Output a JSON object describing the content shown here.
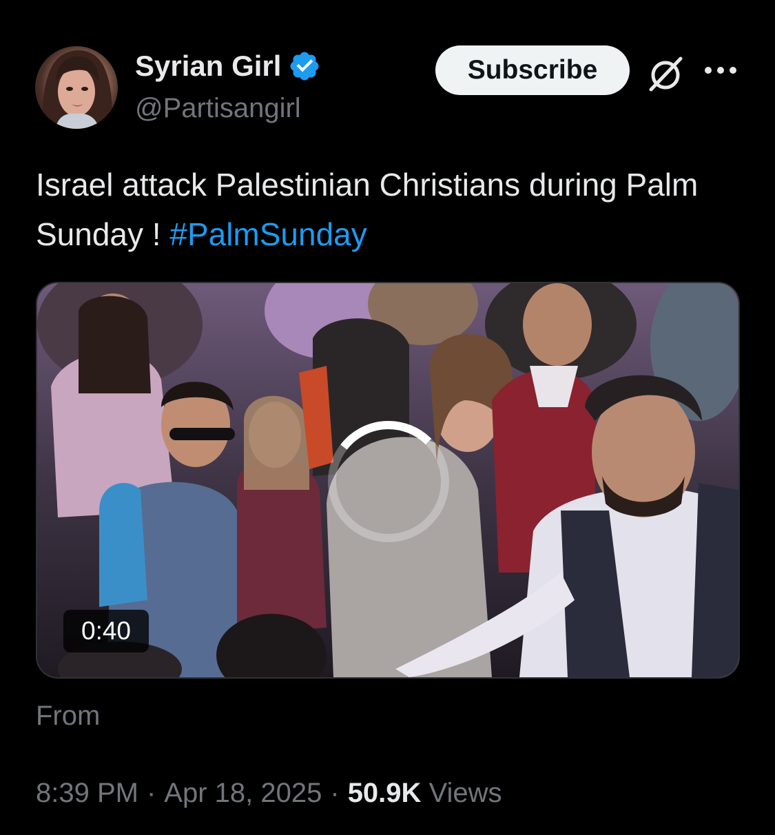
{
  "author": {
    "display_name": "Syrian Girl",
    "handle": "@Partisangirl",
    "verified": true,
    "verified_color": "#1d9bf0"
  },
  "actions": {
    "subscribe_label": "Subscribe",
    "grok_icon": "grok-icon",
    "more_icon": "more-horizontal-icon"
  },
  "tweet": {
    "text": "Israel attack Palestinian Christians during Palm Sunday ! ",
    "hashtag": "#PalmSunday",
    "hashtag_color": "#1d9bf0"
  },
  "media": {
    "type": "video",
    "duration": "0:40",
    "state": "loading"
  },
  "from_label": "From",
  "meta": {
    "time": "8:39 PM",
    "separator": "·",
    "date": "Apr 18, 2025",
    "views_count": "50.9K",
    "views_label": "Views"
  }
}
